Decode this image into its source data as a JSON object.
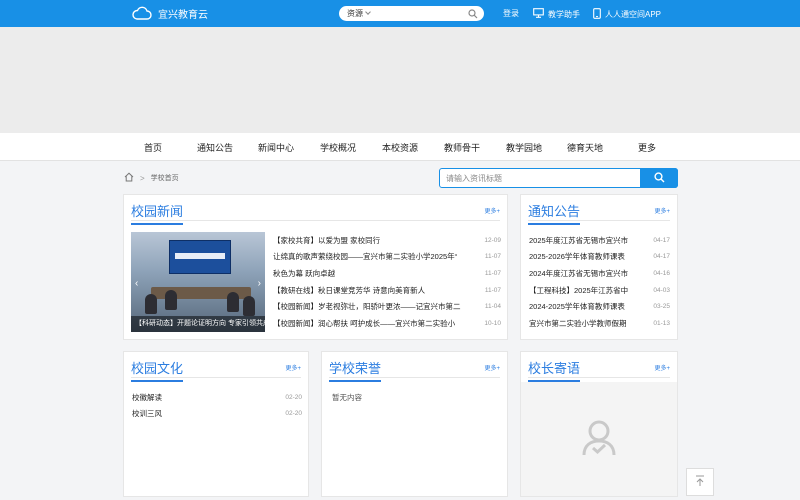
{
  "topbar": {
    "brand": "宜兴教育云",
    "search_scope": "资源",
    "links": {
      "login": "登录",
      "teaching_assistant": "教学助手",
      "app": "人人通空间APP"
    }
  },
  "nav": {
    "items": [
      "首页",
      "通知公告",
      "新闻中心",
      "学校概况",
      "本校资源",
      "教师骨干",
      "教学园地",
      "德育天地",
      "更多"
    ]
  },
  "breadcrumb": {
    "current": "学校首页"
  },
  "news_search": {
    "placeholder": "请输入资讯标题"
  },
  "campus_news": {
    "title": "校园新闻",
    "more": "更多+",
    "photo_caption": "【科研动态】开题论证明方向 专家引领共成",
    "items": [
      {
        "title": "【家校共育】以爱为盟 家校同行",
        "date": "12-09"
      },
      {
        "title": "让绵真的歌声萦绕校园——宜兴市第二实验小学2025年“",
        "date": "11-07"
      },
      {
        "title": "秋色为幕 跃向卓越",
        "date": "11-07"
      },
      {
        "title": "【教研在线】秋日课堂竞芳华 诗意向美育新人",
        "date": "11-07"
      },
      {
        "title": "【校园新闻】岁老视弥壮，阳骄叶更浓——记宜兴市第二",
        "date": "11-04"
      },
      {
        "title": "【校园新闻】润心帮扶 呵护成长——宜兴市第二实验小",
        "date": "10-10"
      }
    ]
  },
  "notices": {
    "title": "通知公告",
    "more": "更多+",
    "items": [
      {
        "title": "2025年度江苏省无锡市宜兴市",
        "date": "04-17"
      },
      {
        "title": "2025-2026学年体育教师课表",
        "date": "04-17"
      },
      {
        "title": "2024年度江苏省无锡市宜兴市",
        "date": "04-16"
      },
      {
        "title": "【工程科技】2025年江苏省中",
        "date": "04-03"
      },
      {
        "title": "2024-2025学年体育教师课表",
        "date": "03-25"
      },
      {
        "title": "宜兴市第二实验小学教师假期",
        "date": "01-13"
      }
    ]
  },
  "culture": {
    "title": "校园文化",
    "more": "更多+",
    "items": [
      {
        "title": "校徽解读",
        "date": "02-20"
      },
      {
        "title": "校训三风",
        "date": "02-20"
      }
    ]
  },
  "honors": {
    "title": "学校荣誉",
    "more": "更多+",
    "empty": "暂无内容"
  },
  "principal": {
    "title": "校长寄语",
    "more": "更多+"
  },
  "colors": {
    "primary": "#1890e6",
    "accent_text": "#2b7de0"
  }
}
